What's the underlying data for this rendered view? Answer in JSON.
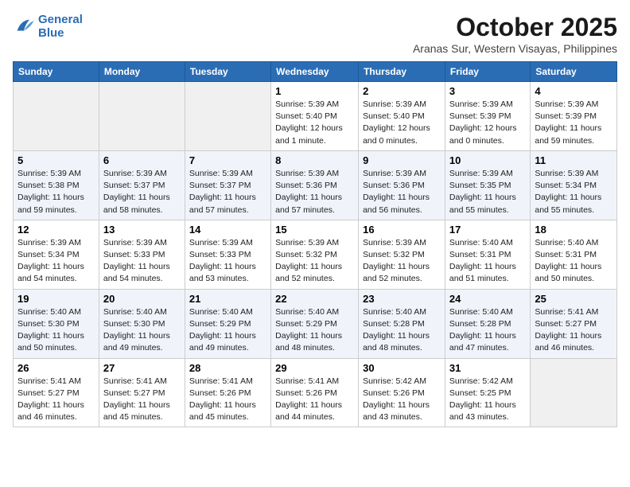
{
  "header": {
    "logo_line1": "General",
    "logo_line2": "Blue",
    "month": "October 2025",
    "location": "Aranas Sur, Western Visayas, Philippines"
  },
  "weekdays": [
    "Sunday",
    "Monday",
    "Tuesday",
    "Wednesday",
    "Thursday",
    "Friday",
    "Saturday"
  ],
  "weeks": [
    [
      {
        "day": "",
        "detail": ""
      },
      {
        "day": "",
        "detail": ""
      },
      {
        "day": "",
        "detail": ""
      },
      {
        "day": "1",
        "detail": "Sunrise: 5:39 AM\nSunset: 5:40 PM\nDaylight: 12 hours\nand 1 minute."
      },
      {
        "day": "2",
        "detail": "Sunrise: 5:39 AM\nSunset: 5:40 PM\nDaylight: 12 hours\nand 0 minutes."
      },
      {
        "day": "3",
        "detail": "Sunrise: 5:39 AM\nSunset: 5:39 PM\nDaylight: 12 hours\nand 0 minutes."
      },
      {
        "day": "4",
        "detail": "Sunrise: 5:39 AM\nSunset: 5:39 PM\nDaylight: 11 hours\nand 59 minutes."
      }
    ],
    [
      {
        "day": "5",
        "detail": "Sunrise: 5:39 AM\nSunset: 5:38 PM\nDaylight: 11 hours\nand 59 minutes."
      },
      {
        "day": "6",
        "detail": "Sunrise: 5:39 AM\nSunset: 5:37 PM\nDaylight: 11 hours\nand 58 minutes."
      },
      {
        "day": "7",
        "detail": "Sunrise: 5:39 AM\nSunset: 5:37 PM\nDaylight: 11 hours\nand 57 minutes."
      },
      {
        "day": "8",
        "detail": "Sunrise: 5:39 AM\nSunset: 5:36 PM\nDaylight: 11 hours\nand 57 minutes."
      },
      {
        "day": "9",
        "detail": "Sunrise: 5:39 AM\nSunset: 5:36 PM\nDaylight: 11 hours\nand 56 minutes."
      },
      {
        "day": "10",
        "detail": "Sunrise: 5:39 AM\nSunset: 5:35 PM\nDaylight: 11 hours\nand 55 minutes."
      },
      {
        "day": "11",
        "detail": "Sunrise: 5:39 AM\nSunset: 5:34 PM\nDaylight: 11 hours\nand 55 minutes."
      }
    ],
    [
      {
        "day": "12",
        "detail": "Sunrise: 5:39 AM\nSunset: 5:34 PM\nDaylight: 11 hours\nand 54 minutes."
      },
      {
        "day": "13",
        "detail": "Sunrise: 5:39 AM\nSunset: 5:33 PM\nDaylight: 11 hours\nand 54 minutes."
      },
      {
        "day": "14",
        "detail": "Sunrise: 5:39 AM\nSunset: 5:33 PM\nDaylight: 11 hours\nand 53 minutes."
      },
      {
        "day": "15",
        "detail": "Sunrise: 5:39 AM\nSunset: 5:32 PM\nDaylight: 11 hours\nand 52 minutes."
      },
      {
        "day": "16",
        "detail": "Sunrise: 5:39 AM\nSunset: 5:32 PM\nDaylight: 11 hours\nand 52 minutes."
      },
      {
        "day": "17",
        "detail": "Sunrise: 5:40 AM\nSunset: 5:31 PM\nDaylight: 11 hours\nand 51 minutes."
      },
      {
        "day": "18",
        "detail": "Sunrise: 5:40 AM\nSunset: 5:31 PM\nDaylight: 11 hours\nand 50 minutes."
      }
    ],
    [
      {
        "day": "19",
        "detail": "Sunrise: 5:40 AM\nSunset: 5:30 PM\nDaylight: 11 hours\nand 50 minutes."
      },
      {
        "day": "20",
        "detail": "Sunrise: 5:40 AM\nSunset: 5:30 PM\nDaylight: 11 hours\nand 49 minutes."
      },
      {
        "day": "21",
        "detail": "Sunrise: 5:40 AM\nSunset: 5:29 PM\nDaylight: 11 hours\nand 49 minutes."
      },
      {
        "day": "22",
        "detail": "Sunrise: 5:40 AM\nSunset: 5:29 PM\nDaylight: 11 hours\nand 48 minutes."
      },
      {
        "day": "23",
        "detail": "Sunrise: 5:40 AM\nSunset: 5:28 PM\nDaylight: 11 hours\nand 48 minutes."
      },
      {
        "day": "24",
        "detail": "Sunrise: 5:40 AM\nSunset: 5:28 PM\nDaylight: 11 hours\nand 47 minutes."
      },
      {
        "day": "25",
        "detail": "Sunrise: 5:41 AM\nSunset: 5:27 PM\nDaylight: 11 hours\nand 46 minutes."
      }
    ],
    [
      {
        "day": "26",
        "detail": "Sunrise: 5:41 AM\nSunset: 5:27 PM\nDaylight: 11 hours\nand 46 minutes."
      },
      {
        "day": "27",
        "detail": "Sunrise: 5:41 AM\nSunset: 5:27 PM\nDaylight: 11 hours\nand 45 minutes."
      },
      {
        "day": "28",
        "detail": "Sunrise: 5:41 AM\nSunset: 5:26 PM\nDaylight: 11 hours\nand 45 minutes."
      },
      {
        "day": "29",
        "detail": "Sunrise: 5:41 AM\nSunset: 5:26 PM\nDaylight: 11 hours\nand 44 minutes."
      },
      {
        "day": "30",
        "detail": "Sunrise: 5:42 AM\nSunset: 5:26 PM\nDaylight: 11 hours\nand 43 minutes."
      },
      {
        "day": "31",
        "detail": "Sunrise: 5:42 AM\nSunset: 5:25 PM\nDaylight: 11 hours\nand 43 minutes."
      },
      {
        "day": "",
        "detail": ""
      }
    ]
  ]
}
